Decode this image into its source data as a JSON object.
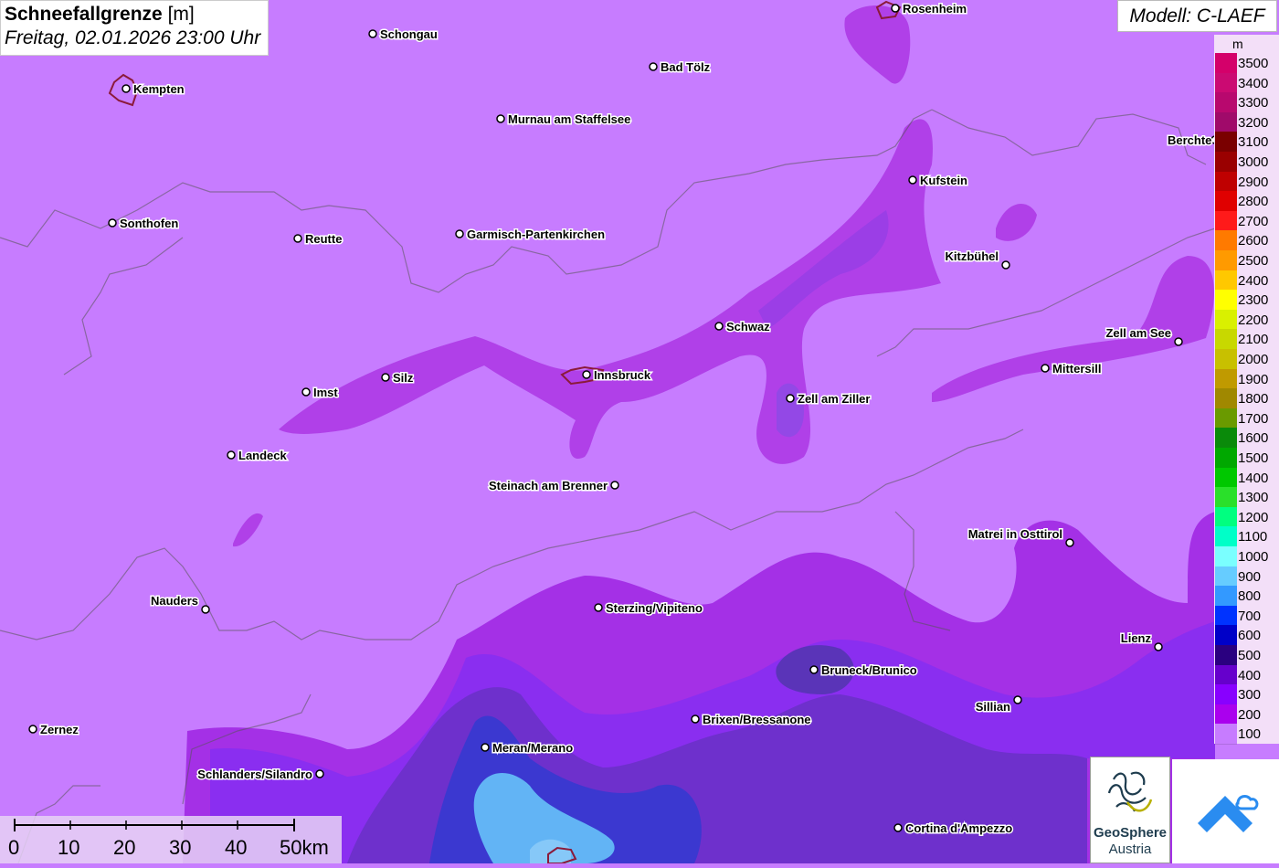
{
  "title": {
    "main": "Schneefallgrenze",
    "unit": "[m]",
    "datetime": "Freitag, 02.01.2026 23:00 Uhr"
  },
  "model": "Modell: C-LAEF",
  "legend": {
    "unit": "m",
    "items": [
      {
        "label": "3500",
        "color": "#d4006a"
      },
      {
        "label": "3400",
        "color": "#cb0a72"
      },
      {
        "label": "3300",
        "color": "#b8086e"
      },
      {
        "label": "3200",
        "color": "#a00a6a"
      },
      {
        "label": "3100",
        "color": "#7a0000"
      },
      {
        "label": "3000",
        "color": "#9a0000"
      },
      {
        "label": "2900",
        "color": "#bf0000"
      },
      {
        "label": "2800",
        "color": "#e00000"
      },
      {
        "label": "2700",
        "color": "#ff1a1a"
      },
      {
        "label": "2600",
        "color": "#ff7a00"
      },
      {
        "label": "2500",
        "color": "#ff9a00"
      },
      {
        "label": "2400",
        "color": "#ffc800"
      },
      {
        "label": "2300",
        "color": "#ffff00"
      },
      {
        "label": "2200",
        "color": "#d9f000"
      },
      {
        "label": "2100",
        "color": "#c8d800"
      },
      {
        "label": "2000",
        "color": "#c8c000"
      },
      {
        "label": "1900",
        "color": "#c09a00"
      },
      {
        "label": "1800",
        "color": "#a08800"
      },
      {
        "label": "1700",
        "color": "#6a9a00"
      },
      {
        "label": "1600",
        "color": "#0a8a0a"
      },
      {
        "label": "1500",
        "color": "#00a800"
      },
      {
        "label": "1400",
        "color": "#00c800"
      },
      {
        "label": "1300",
        "color": "#2ae02a"
      },
      {
        "label": "1200",
        "color": "#00ff80"
      },
      {
        "label": "1100",
        "color": "#00ffc8"
      },
      {
        "label": "1000",
        "color": "#7affff"
      },
      {
        "label": "900",
        "color": "#66ccff"
      },
      {
        "label": "800",
        "color": "#3399ff"
      },
      {
        "label": "700",
        "color": "#0033ff"
      },
      {
        "label": "600",
        "color": "#0000c8"
      },
      {
        "label": "500",
        "color": "#2a0080"
      },
      {
        "label": "400",
        "color": "#6600cc"
      },
      {
        "label": "300",
        "color": "#8800ff"
      },
      {
        "label": "200",
        "color": "#aa00ee"
      },
      {
        "label": "100",
        "color": "#c77cff"
      }
    ]
  },
  "cities": [
    {
      "name": "Rosenheim"
    },
    {
      "name": "Schongau"
    },
    {
      "name": "Kempten"
    },
    {
      "name": "Bad Tölz"
    },
    {
      "name": "Murnau am Staffelsee"
    },
    {
      "name": "Berchte"
    },
    {
      "name": "Kufstein"
    },
    {
      "name": "Sonthofen"
    },
    {
      "name": "Reutte"
    },
    {
      "name": "Garmisch-Partenkirchen"
    },
    {
      "name": "Kitzbühel"
    },
    {
      "name": "Schwaz"
    },
    {
      "name": "Zell am See"
    },
    {
      "name": "Mittersill"
    },
    {
      "name": "Imst"
    },
    {
      "name": "Silz"
    },
    {
      "name": "Innsbruck"
    },
    {
      "name": "Zell am Ziller"
    },
    {
      "name": "Landeck"
    },
    {
      "name": "Steinach am Brenner"
    },
    {
      "name": "Matrei in Osttirol"
    },
    {
      "name": "Nauders"
    },
    {
      "name": "Sterzing/Vipiteno"
    },
    {
      "name": "Lienz"
    },
    {
      "name": "Bruneck/Brunico"
    },
    {
      "name": "Sillian"
    },
    {
      "name": "Brixen/Bressanone"
    },
    {
      "name": "Zernez"
    },
    {
      "name": "Meran/Merano"
    },
    {
      "name": "Schlanders/Silandro"
    },
    {
      "name": "Cortina d'Ampezzo"
    }
  ],
  "scalebar": {
    "labels": [
      "0",
      "10",
      "20",
      "30",
      "40",
      "50km"
    ]
  },
  "logos": {
    "geosphere_line1": "GeoSphere",
    "geosphere_line2": "Austria"
  }
}
